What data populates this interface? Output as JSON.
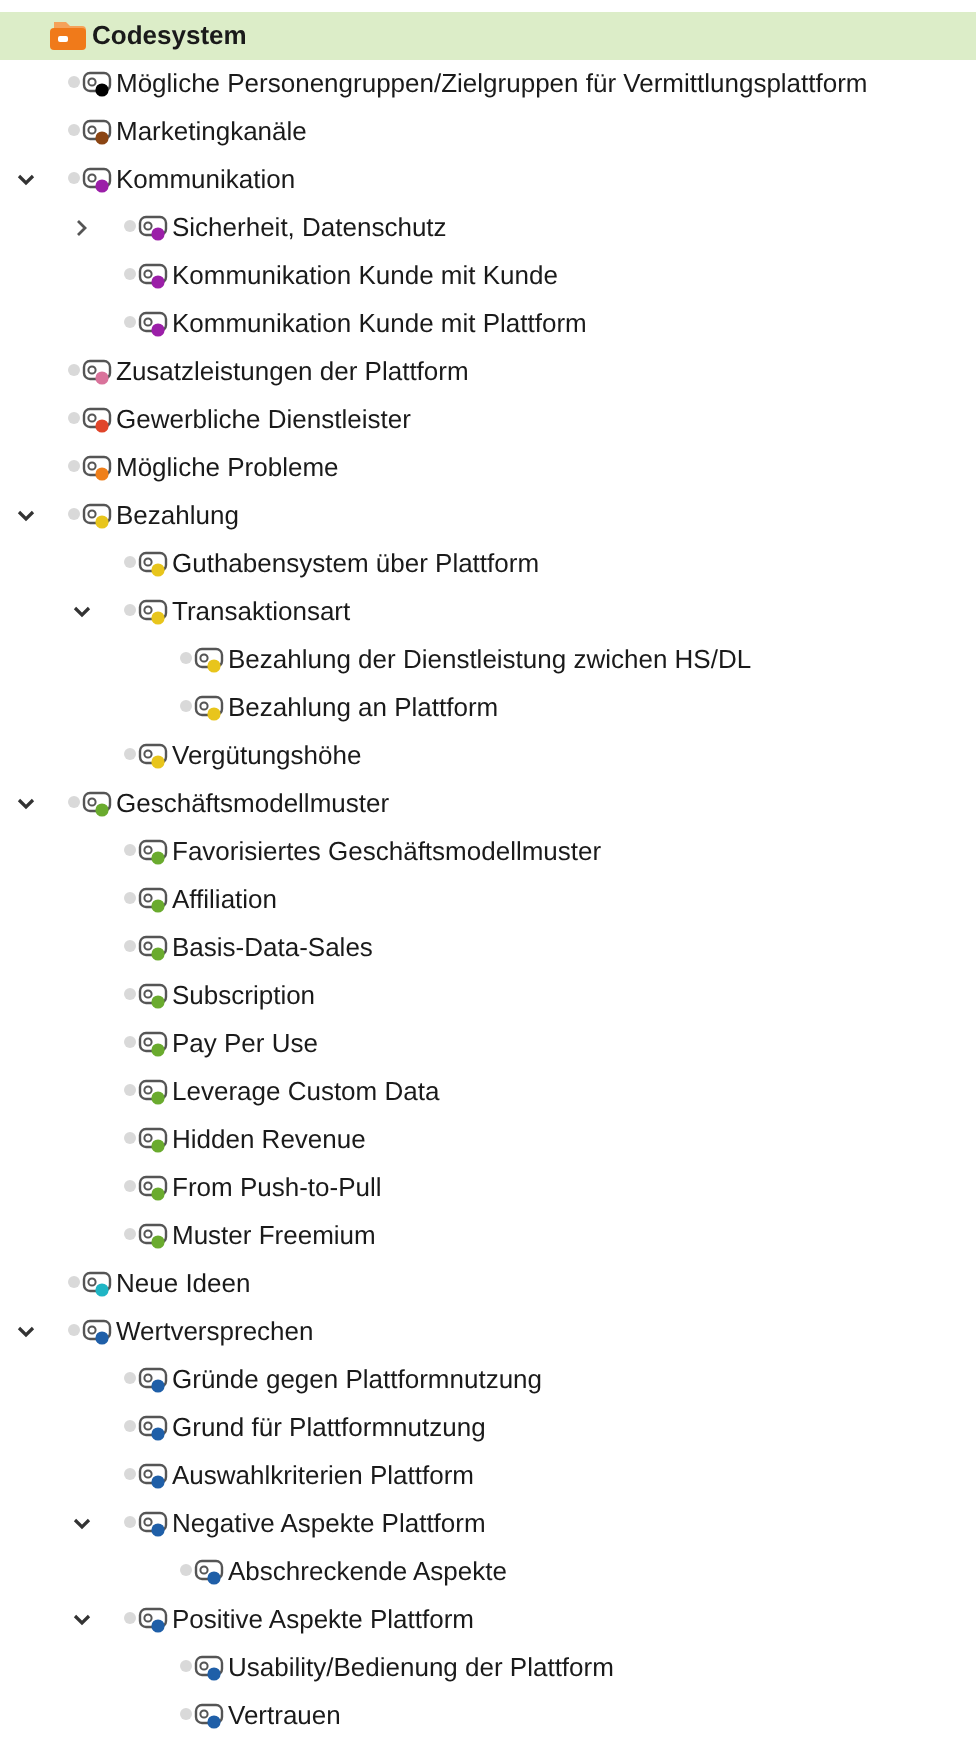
{
  "root": {
    "label": "Codesystem",
    "selected": true
  },
  "codes": [
    {
      "label": "Mögliche Personengruppen/Zielgruppen für Vermittlungsplattform",
      "color": "#000000"
    },
    {
      "label": "Marketingkanäle",
      "color": "#8b4513"
    },
    {
      "label": "Kommunikation",
      "color": "#9b1fa8",
      "expanded": true,
      "children": [
        {
          "label": "Sicherheit, Datenschutz",
          "color": "#9b1fa8",
          "expanded": false
        },
        {
          "label": "Kommunikation Kunde mit Kunde",
          "color": "#9b1fa8"
        },
        {
          "label": "Kommunikation Kunde mit Plattform",
          "color": "#9b1fa8"
        }
      ]
    },
    {
      "label": "Zusatzleistungen der Plattform",
      "color": "#d9739b"
    },
    {
      "label": "Gewerbliche Dienstleister",
      "color": "#e0452a"
    },
    {
      "label": "Mögliche Probleme",
      "color": "#ef7f1a"
    },
    {
      "label": "Bezahlung",
      "color": "#e8c51c",
      "expanded": true,
      "children": [
        {
          "label": "Guthabensystem über Plattform",
          "color": "#e8c51c"
        },
        {
          "label": "Transaktionsart",
          "color": "#e8c51c",
          "expanded": true,
          "children": [
            {
              "label": "Bezahlung der Dienstleistung zwichen HS/DL",
              "color": "#e8c51c"
            },
            {
              "label": "Bezahlung an Plattform",
              "color": "#e8c51c"
            }
          ]
        },
        {
          "label": "Vergütungshöhe",
          "color": "#e8c51c"
        }
      ]
    },
    {
      "label": "Geschäftsmodellmuster",
      "color": "#6aab2e",
      "expanded": true,
      "children": [
        {
          "label": "Favorisiertes Geschäftsmodellmuster",
          "color": "#6aab2e"
        },
        {
          "label": "Affiliation",
          "color": "#6aab2e"
        },
        {
          "label": "Basis-Data-Sales",
          "color": "#6aab2e"
        },
        {
          "label": "Subscription",
          "color": "#6aab2e"
        },
        {
          "label": "Pay Per Use",
          "color": "#6aab2e"
        },
        {
          "label": "Leverage Custom Data",
          "color": "#6aab2e"
        },
        {
          "label": "Hidden Revenue",
          "color": "#6aab2e"
        },
        {
          "label": "From Push-to-Pull",
          "color": "#6aab2e"
        },
        {
          "label": "Muster Freemium",
          "color": "#6aab2e"
        }
      ]
    },
    {
      "label": "Neue Ideen",
      "color": "#1fb5c4"
    },
    {
      "label": "Wertversprechen",
      "color": "#1f5fa8",
      "expanded": true,
      "children": [
        {
          "label": "Gründe gegen Plattformnutzung",
          "color": "#1f5fa8"
        },
        {
          "label": "Grund für Plattformnutzung",
          "color": "#1f5fa8"
        },
        {
          "label": "Auswahlkriterien Plattform",
          "color": "#1f5fa8"
        },
        {
          "label": "Negative Aspekte Plattform",
          "color": "#1f5fa8",
          "expanded": true,
          "children": [
            {
              "label": "Abschreckende Aspekte",
              "color": "#1f5fa8"
            }
          ]
        },
        {
          "label": "Positive Aspekte Plattform",
          "color": "#1f5fa8",
          "expanded": true,
          "children": [
            {
              "label": "Usability/Bedienung der Plattform",
              "color": "#1f5fa8"
            },
            {
              "label": "Vertrauen",
              "color": "#1f5fa8"
            }
          ]
        }
      ]
    }
  ]
}
